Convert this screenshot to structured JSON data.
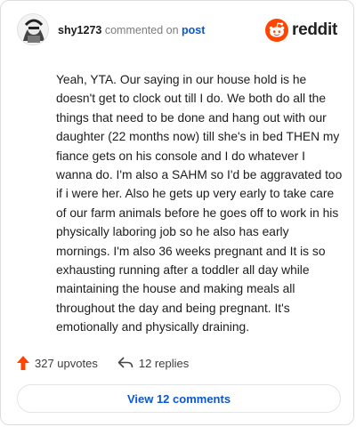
{
  "comment": {
    "username": "shy1273",
    "action_text": "commented on",
    "target_text": "post",
    "body": "Yeah, YTA. Our saying in our house hold is he doesn't get to clock out till I do. We both do all the things that need to be done and hang out with our daughter (22 months now) till she's in bed THEN my fiance gets on his console and I do whatever I wanna do. I'm also a SAHM so I'd be aggravated too if i were her. Also he gets up very early to take care of our farm animals before he goes off to work in his physically laboring job so he also has early mornings. I'm also 36 weeks pregnant and It is so exhausting running after a toddler all day while maintaining the house and making meals all throughout the day and being pregnant. It's emotionally and physically draining.",
    "upvotes_label": "327 upvotes",
    "replies_label": "12 replies",
    "view_comments_label": "View 12 comments"
  },
  "brand": {
    "name": "reddit",
    "accent_color": "#ff4500"
  },
  "icons": {
    "avatar": "avatar",
    "logo": "reddit-logo-icon",
    "upvote": "upvote-arrow-icon",
    "reply": "reply-arrow-icon"
  }
}
